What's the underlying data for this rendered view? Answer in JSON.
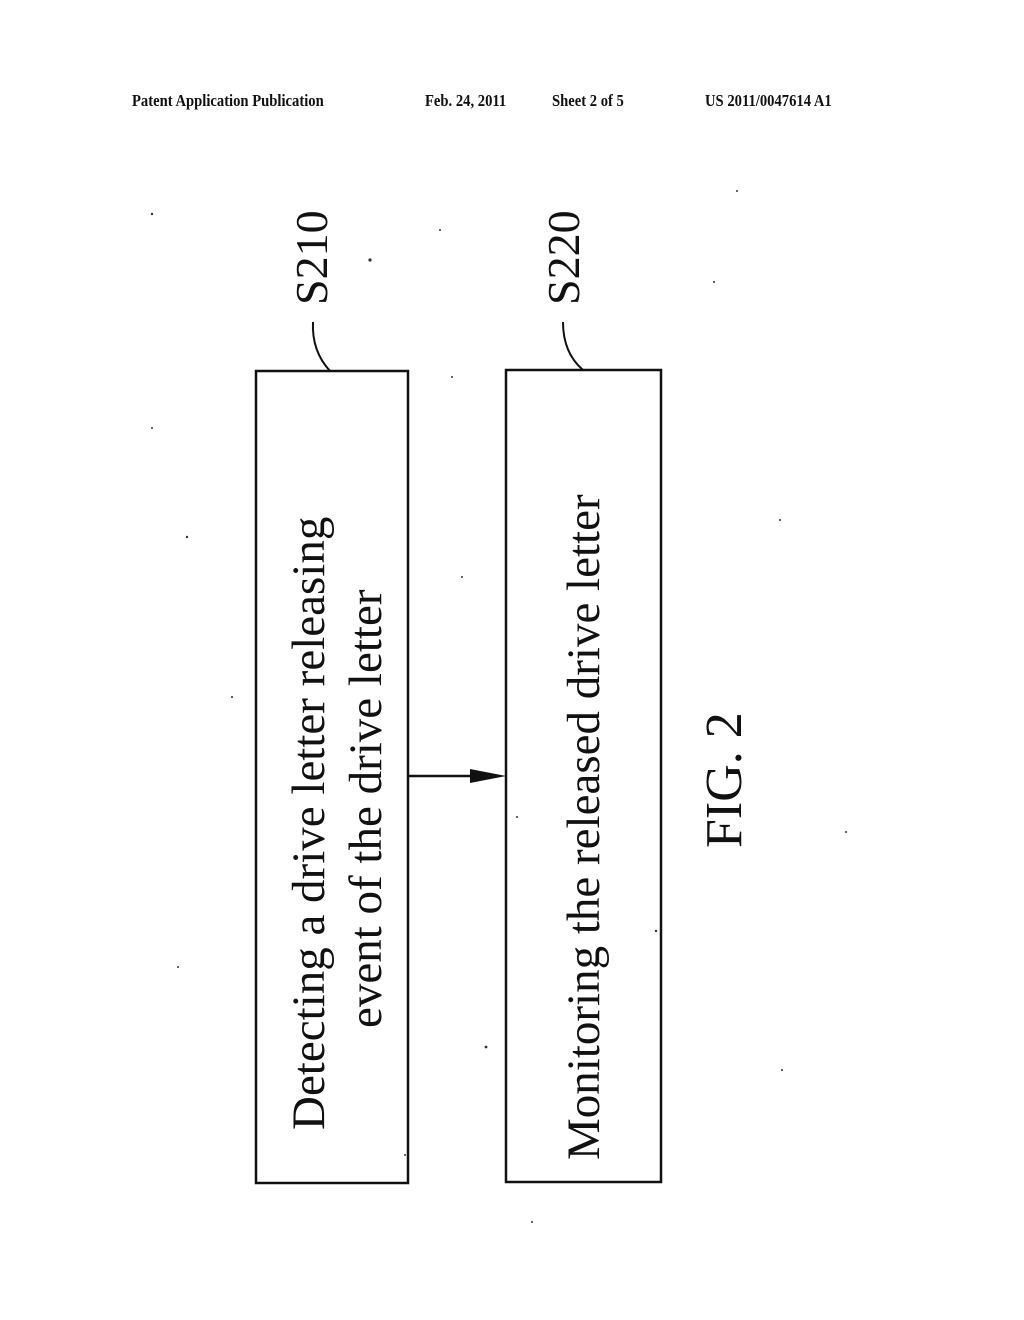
{
  "header": {
    "publication": "Patent Application Publication",
    "date": "Feb. 24, 2011",
    "sheet": "Sheet 2 of 5",
    "patent_number": "US 2011/0047614 A1"
  },
  "diagram": {
    "figure_label": "FIG. 2",
    "steps": [
      {
        "id": "S210",
        "lines": [
          "Detecting a drive letter releasing",
          "event of the drive letter"
        ]
      },
      {
        "id": "S220",
        "lines": [
          "Monitoring the released drive letter"
        ]
      }
    ],
    "connections": [
      {
        "from": "S210",
        "to": "S220",
        "type": "arrow"
      }
    ]
  }
}
